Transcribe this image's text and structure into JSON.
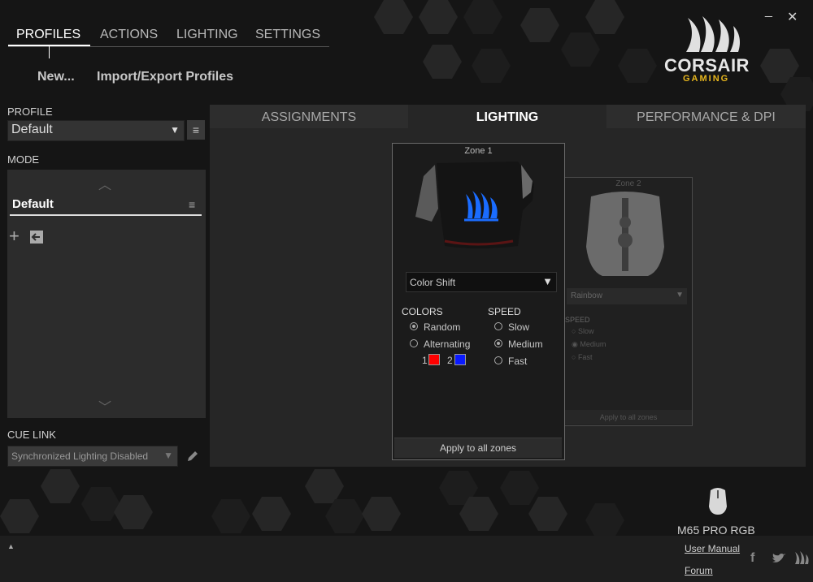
{
  "nav": {
    "tabs": [
      "PROFILES",
      "ACTIONS",
      "LIGHTING",
      "SETTINGS"
    ],
    "actions": {
      "new": "New...",
      "import_export": "Import/Export Profiles"
    }
  },
  "window": {
    "minimize": "_",
    "close": "✕"
  },
  "brand": {
    "name": "CORSAIR",
    "sub": "GAMING",
    "accent": "#e7b61d"
  },
  "profile": {
    "label": "PROFILE",
    "selected": "Default",
    "menu_icon": "≡"
  },
  "mode": {
    "label": "MODE",
    "item": "Default",
    "menu_icon": "≡",
    "up": "︿",
    "down": "﹀"
  },
  "cue_link": {
    "label": "CUE LINK",
    "selected": "Synchronized Lighting Disabled"
  },
  "tabs": {
    "assignments": "ASSIGNMENTS",
    "lighting": "LIGHTING",
    "performance": "PERFORMANCE & DPI"
  },
  "zone1": {
    "title": "Zone 1",
    "effect": "Color Shift",
    "colors_label": "COLORS",
    "speed_label": "SPEED",
    "colors_options": [
      "Random",
      "Alternating"
    ],
    "color_selected": "Random",
    "color_swatches": [
      {
        "index": "1",
        "color": "#ff0000"
      },
      {
        "index": "2",
        "color": "#0a1aff"
      }
    ],
    "speed_options": [
      "Slow",
      "Medium",
      "Fast"
    ],
    "speed_selected": "Medium",
    "apply": "Apply to all zones"
  },
  "zone2": {
    "title": "Zone 2",
    "effect": "Rainbow",
    "speed_label": "SPEED",
    "speed_options": [
      "Slow",
      "Medium",
      "Fast"
    ],
    "speed_selected": "Medium",
    "apply": "Apply to all zones"
  },
  "device": {
    "name": "M65 PRO RGB"
  },
  "footer": {
    "user_manual": "User Manual",
    "forum": "Forum",
    "collapse": "▲"
  }
}
